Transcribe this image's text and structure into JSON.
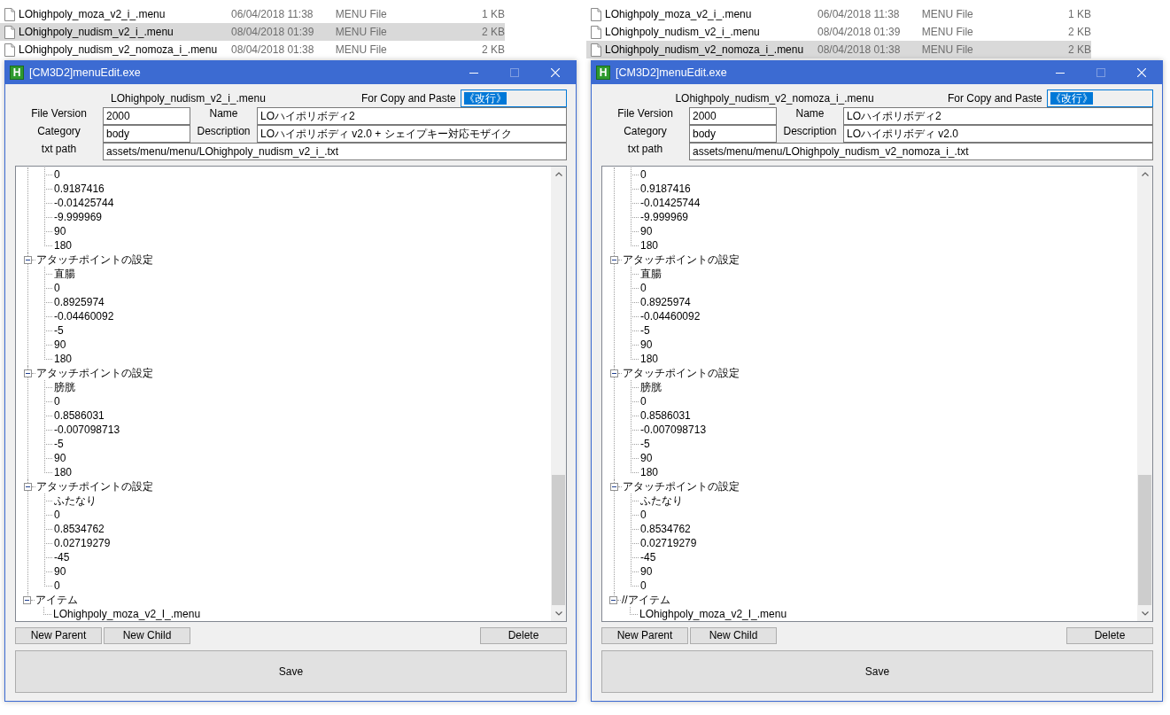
{
  "panes": [
    {
      "files": [
        {
          "name": "LOhighpoly_moza_v2_i_.menu",
          "date": "06/04/2018 11:38",
          "type": "MENU File",
          "size": "1 KB",
          "selected": false
        },
        {
          "name": "LOhighpoly_nudism_v2_i_.menu",
          "date": "08/04/2018 01:39",
          "type": "MENU File",
          "size": "2 KB",
          "selected": true
        },
        {
          "name": "LOhighpoly_nudism_v2_nomoza_i_.menu",
          "date": "08/04/2018 01:38",
          "type": "MENU File",
          "size": "2 KB",
          "selected": false
        }
      ],
      "window": {
        "icon_letter": "H",
        "title": "[CM3D2]menuEdit.exe",
        "file_name": "LOhighpoly_nudism_v2_i_.menu",
        "copy_label": "For Copy and Paste",
        "copy_value": "《改行》",
        "fields": [
          {
            "label": "File Version",
            "value": "2000"
          },
          {
            "label": "Name",
            "value": "LOハイポリボディ2"
          },
          {
            "label": "Category",
            "value": "body"
          },
          {
            "label": "Description",
            "value": "LOハイポリボディ v2.0 + シェイプキー対応モザイク"
          },
          {
            "label": "txt path",
            "value": "assets/menu/menu/LOhighpoly_nudism_v2_i_.txt"
          }
        ],
        "tree": [
          {
            "children": [
              "0",
              "0.9187416",
              "-0.01425744",
              "-9.999969",
              "90",
              "180"
            ]
          },
          {
            "label": "アタッチポイントの設定",
            "expanded": true,
            "children": [
              "直腸",
              "0",
              "0.8925974",
              "-0.04460092",
              "-5",
              "90",
              "180"
            ]
          },
          {
            "label": "アタッチポイントの設定",
            "expanded": true,
            "children": [
              "膀胱",
              "0",
              "0.8586031",
              "-0.007098713",
              "-5",
              "90",
              "180"
            ]
          },
          {
            "label": "アタッチポイントの設定",
            "expanded": true,
            "children": [
              "ふたなり",
              "0",
              "0.8534762",
              "0.02719279",
              "-45",
              "90",
              "0"
            ]
          },
          {
            "label": "アイテム",
            "expanded": true,
            "children": [
              "LOhighpoly_moza_v2_I_.menu"
            ]
          }
        ],
        "buttons": [
          "New Parent",
          "New Child",
          "Delete"
        ],
        "save_button": "Save"
      }
    },
    {
      "files": [
        {
          "name": "LOhighpoly_moza_v2_i_.menu",
          "date": "06/04/2018 11:38",
          "type": "MENU File",
          "size": "1 KB",
          "selected": false
        },
        {
          "name": "LOhighpoly_nudism_v2_i_.menu",
          "date": "08/04/2018 01:39",
          "type": "MENU File",
          "size": "2 KB",
          "selected": false
        },
        {
          "name": "LOhighpoly_nudism_v2_nomoza_i_.menu",
          "date": "08/04/2018 01:38",
          "type": "MENU File",
          "size": "2 KB",
          "selected": true
        }
      ],
      "window": {
        "icon_letter": "H",
        "title": "[CM3D2]menuEdit.exe",
        "file_name": "LOhighpoly_nudism_v2_nomoza_i_.menu",
        "copy_label": "For Copy and Paste",
        "copy_value": "《改行》",
        "fields": [
          {
            "label": "File Version",
            "value": "2000"
          },
          {
            "label": "Name",
            "value": "LOハイポリボディ2"
          },
          {
            "label": "Category",
            "value": "body"
          },
          {
            "label": "Description",
            "value": "LOハイポリボディ v2.0"
          },
          {
            "label": "txt path",
            "value": "assets/menu/menu/LOhighpoly_nudism_v2_nomoza_i_.txt"
          }
        ],
        "tree": [
          {
            "children": [
              "0",
              "0.9187416",
              "-0.01425744",
              "-9.999969",
              "90",
              "180"
            ]
          },
          {
            "label": "アタッチポイントの設定",
            "expanded": true,
            "children": [
              "直腸",
              "0",
              "0.8925974",
              "-0.04460092",
              "-5",
              "90",
              "180"
            ]
          },
          {
            "label": "アタッチポイントの設定",
            "expanded": true,
            "children": [
              "膀胱",
              "0",
              "0.8586031",
              "-0.007098713",
              "-5",
              "90",
              "180"
            ]
          },
          {
            "label": "アタッチポイントの設定",
            "expanded": true,
            "children": [
              "ふたなり",
              "0",
              "0.8534762",
              "0.02719279",
              "-45",
              "90",
              "0"
            ]
          },
          {
            "label": "//アイテム",
            "expanded": true,
            "children": [
              "LOhighpoly_moza_v2_I_.menu"
            ]
          }
        ],
        "buttons": [
          "New Parent",
          "New Child",
          "Delete"
        ],
        "save_button": "Save"
      }
    }
  ]
}
